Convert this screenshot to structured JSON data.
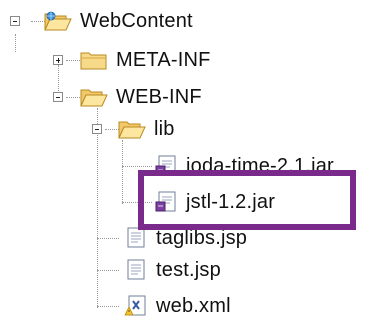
{
  "tree": {
    "root": {
      "label": "WebContent",
      "icon": "folder-open-icon",
      "expanded": true
    },
    "meta_inf": {
      "label": "META-INF",
      "icon": "folder-icon",
      "expanded": false
    },
    "web_inf": {
      "label": "WEB-INF",
      "icon": "folder-open-icon",
      "expanded": true
    },
    "lib": {
      "label": "lib",
      "icon": "folder-open-icon",
      "expanded": true
    },
    "joda": {
      "label": "joda-time-2.1.jar",
      "icon": "jar-file-icon"
    },
    "jstl": {
      "label": "jstl-1.2.jar",
      "icon": "jar-file-icon"
    },
    "taglibs": {
      "label": "taglibs.jsp",
      "icon": "jsp-file-icon"
    },
    "test": {
      "label": "test.jsp",
      "icon": "jsp-file-icon"
    },
    "webxml": {
      "label": "web.xml",
      "icon": "xml-file-icon"
    }
  },
  "highlight_color": "#7a2a8a"
}
